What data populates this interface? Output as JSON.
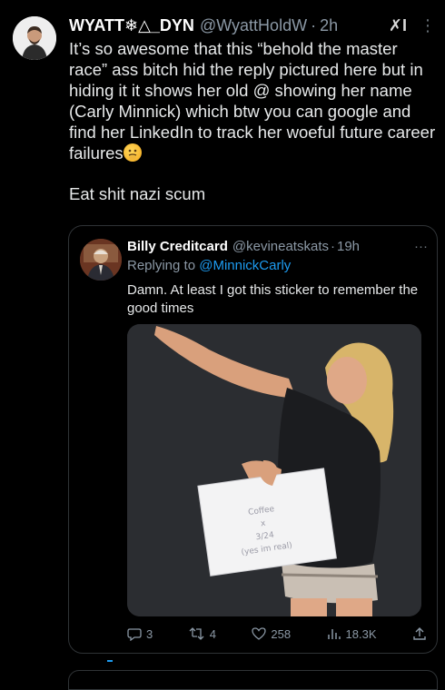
{
  "tweet": {
    "display_name": "WYATT❄△_DYN",
    "handle": "@WyattHoldW",
    "sep": "·",
    "time": "2h",
    "grok_label": "✗I",
    "more_label": "⋮",
    "text_lines": [
      "It’s so awesome that this “behold the master race” ass bitch hid the reply pictured here but in hiding it it shows her old @ showing her name (Carly Minnick) which btw you can google and find her LinkedIn to track her woeful future career failures",
      "Eat shit nazi scum"
    ],
    "emoji": "thinking-face-emoji"
  },
  "quoted": {
    "display_name": "Billy Creditcard",
    "handle": "@kevineatskats",
    "sep": "·",
    "time": "19h",
    "more_label": "···",
    "replying_prefix": "Replying to",
    "replying_handle": "@MinnickCarly",
    "text": "Damn. At least I got this sticker to remember the good times",
    "sign_lines": [
      "Coffee",
      "x",
      "3/24",
      "(yes im real)"
    ],
    "actions": {
      "replies": "3",
      "reposts": "4",
      "likes": "258",
      "views": "18.3K"
    }
  },
  "colors": {
    "background": "#000000",
    "text": "#e7e9ea",
    "muted": "#8b98a5",
    "accent": "#1d9bf0"
  }
}
